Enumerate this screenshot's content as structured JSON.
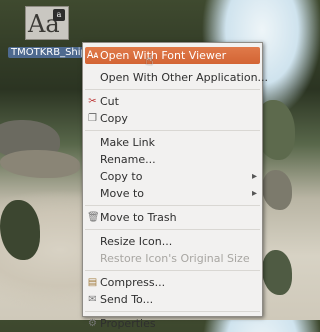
{
  "desktop": {
    "file_icon_glyph": "Aa",
    "file_badge_glyph": "a",
    "file_name": "TMOTKRB_Ship.ttf"
  },
  "menu": {
    "items": [
      {
        "label": "Open With Font Viewer",
        "icon": "font-viewer-icon",
        "selected": true
      },
      {
        "label": "Open With Other Application..."
      },
      {
        "label": "Cut",
        "icon": "scissors-icon"
      },
      {
        "label": "Copy",
        "icon": "copy-icon"
      },
      {
        "label": "Make Link"
      },
      {
        "label": "Rename..."
      },
      {
        "label": "Copy to",
        "submenu": true
      },
      {
        "label": "Move to",
        "submenu": true
      },
      {
        "label": "Move to Trash",
        "icon": "trash-icon"
      },
      {
        "label": "Resize Icon..."
      },
      {
        "label": "Restore Icon's Original Size",
        "disabled": true
      },
      {
        "label": "Compress...",
        "icon": "archive-icon"
      },
      {
        "label": "Send To...",
        "icon": "send-icon"
      },
      {
        "label": "Properties",
        "icon": "properties-icon"
      }
    ]
  },
  "colors": {
    "selection": "#d9693b",
    "menu_background": "#f2f1f0",
    "label_background": "#4e6a8f"
  }
}
